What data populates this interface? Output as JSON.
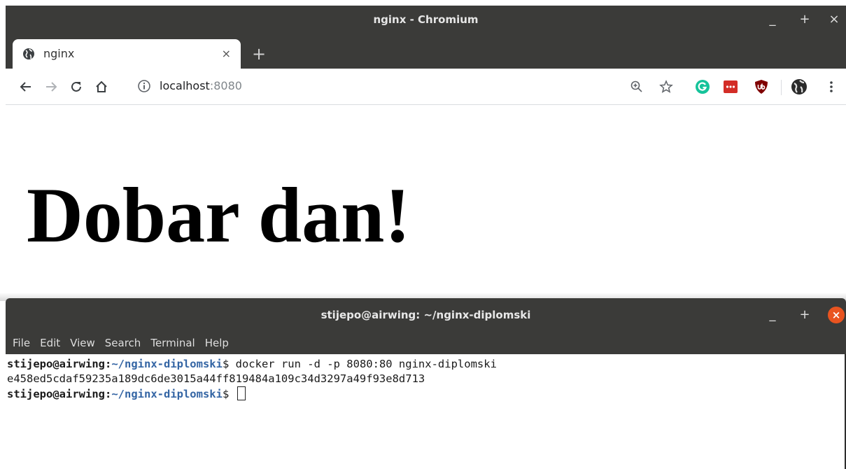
{
  "browser": {
    "window_title": "nginx - Chromium",
    "controls": {
      "minimize": "_",
      "maximize": "+",
      "close": "×"
    },
    "tab": {
      "title": "nginx",
      "close": "×"
    },
    "new_tab": "+",
    "address": {
      "host": "localhost",
      "port": ":8080"
    },
    "page": {
      "heading": "Dobar dan!"
    }
  },
  "terminal": {
    "window_title": "stijepo@airwing: ~/nginx-diplomski",
    "controls": {
      "minimize": "_",
      "maximize": "+",
      "close": "×"
    },
    "menu": [
      "File",
      "Edit",
      "View",
      "Search",
      "Terminal",
      "Help"
    ],
    "lines": [
      {
        "user": "stijepo@airwing",
        "sep": ":",
        "path": "~/nginx-diplomski",
        "dollar": "$ ",
        "command": "docker run -d -p 8080:80 nginx-diplomski"
      },
      {
        "output": "e458ed5cdaf59235a189dc6de3015a44ff819484a109c34d3297a49f93e8d713"
      },
      {
        "user": "stijepo@airwing",
        "sep": ":",
        "path": "~/nginx-diplomski",
        "dollar": "$ ",
        "command": ""
      }
    ]
  },
  "colors": {
    "titlebar": "#3b3b39",
    "prompt_path": "#3465a4",
    "terminal_close": "#e95420",
    "grammarly": "#15c39a",
    "lastpass": "#d32d27",
    "ublock": "#800000"
  }
}
